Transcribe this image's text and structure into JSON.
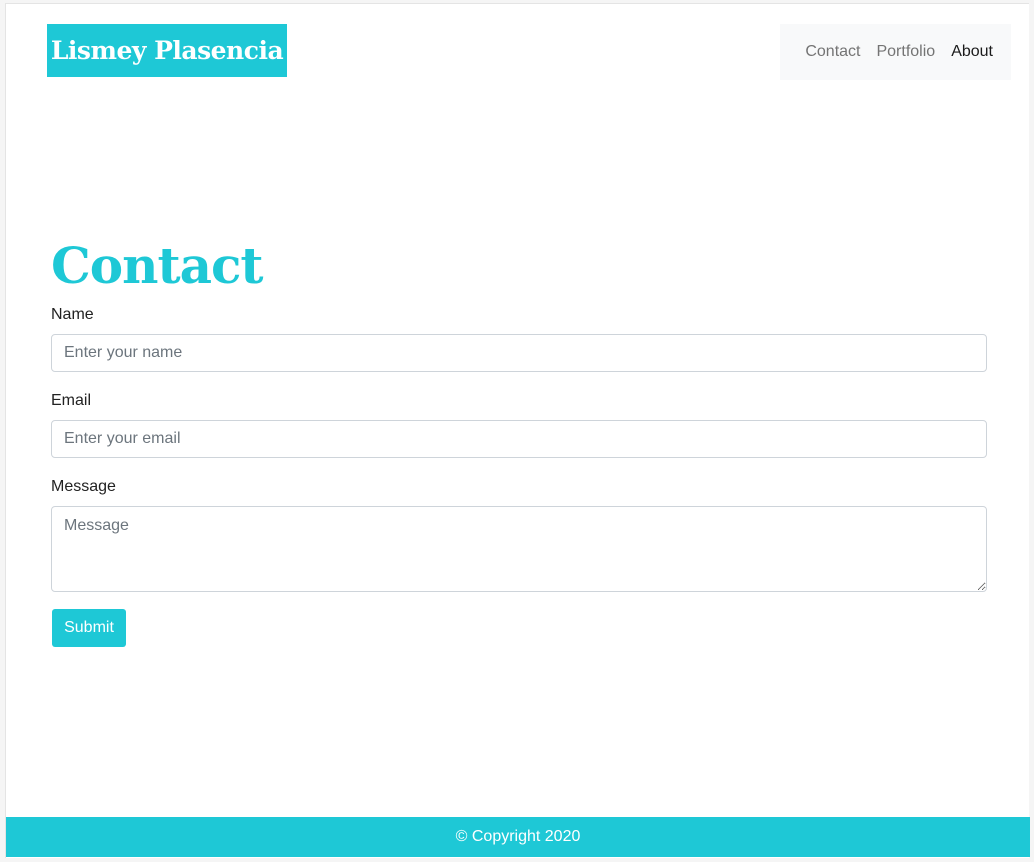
{
  "brand": {
    "name": "Lismey Plasencia",
    "color": "#1ec8d6"
  },
  "nav": {
    "items": [
      {
        "label": "Contact",
        "active": false
      },
      {
        "label": "Portfolio",
        "active": false
      },
      {
        "label": "About",
        "active": true
      }
    ]
  },
  "main": {
    "title": "Contact",
    "form": {
      "name_label": "Name",
      "name_placeholder": "Enter your name",
      "name_value": "",
      "email_label": "Email",
      "email_placeholder": "Enter your email",
      "email_value": "",
      "message_label": "Message",
      "message_placeholder": "Message",
      "message_value": "",
      "submit_label": "Submit"
    }
  },
  "footer": {
    "copyright": "© Copyright 2020"
  },
  "colors": {
    "accent": "#1ec8d6",
    "nav_background": "#f8f9fa",
    "nav_text": "#747474",
    "nav_active_text": "#1b1b1b"
  }
}
